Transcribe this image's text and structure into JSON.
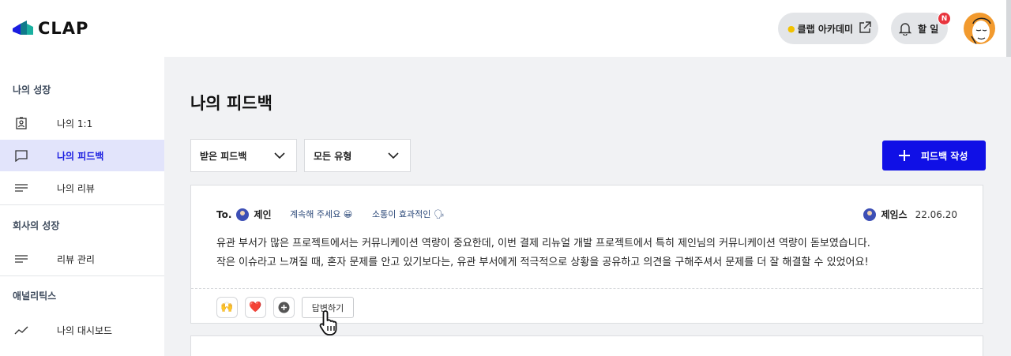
{
  "header": {
    "logo_text": "CLAP",
    "academy_label": "클랩 아카데미",
    "todo_label": "할 일",
    "todo_badge": "N"
  },
  "sidebar": {
    "sections": [
      {
        "title": "나의 성장"
      },
      {
        "title": "회사의 성장"
      },
      {
        "title": "애널리틱스"
      }
    ],
    "items": [
      {
        "label": "나의 1:1",
        "icon": "badge-icon"
      },
      {
        "label": "나의 피드백",
        "icon": "chat-icon",
        "active": true
      },
      {
        "label": "나의 리뷰",
        "icon": "lines-icon"
      },
      {
        "label": "리뷰 관리",
        "icon": "lines-icon"
      },
      {
        "label": "나의 대시보드",
        "icon": "trend-icon"
      }
    ]
  },
  "main": {
    "title": "나의 피드백",
    "filter_received": "받은 피드백",
    "filter_type": "모든 유형",
    "write_button": "피드백 작성"
  },
  "feedback": {
    "to_prefix": "To.",
    "to_name": "제인",
    "tag1": "계속해 주세요 😀",
    "tag2": "소통이 효과적인 🗣",
    "from_name": "제임스",
    "date": "22.06.20",
    "line1": "유관 부서가 많은 프로젝트에서는 커뮤니케이션 역량이 중요한데, 이번 결제 리뉴얼 개발 프로젝트에서 특히 제인님의 커뮤니케이션 역량이 돋보였습니다.",
    "line2": "작은 이슈라고 느껴질 때, 혼자 문제를 안고 있기보다는, 유관 부서에게 적극적으로 상황을 공유하고 의견을 구해주셔서 문제를 더 잘 해결할 수 있었어요!",
    "reaction1": "🙌",
    "reaction2": "❤️",
    "reply_label": "답변하기"
  },
  "colors": {
    "accent": "#1010e6",
    "active_bg": "#e2e4fb",
    "badge": "#e8343d"
  }
}
